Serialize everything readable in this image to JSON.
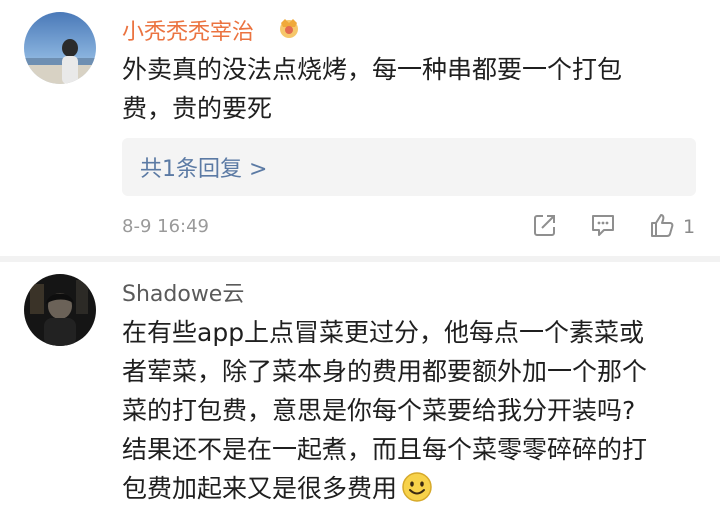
{
  "comments": [
    {
      "username": "小秃秃秃宰治",
      "lines": [
        "外卖真的没法点烧烤，每一种串都要一个打包",
        "费，贵的要死"
      ],
      "replies_label": "共1条回复 >",
      "timestamp": "8-9 16:49",
      "like_count": "1",
      "icons": [
        "vip-crown-icon",
        "share-icon",
        "comment-icon",
        "like-icon"
      ]
    },
    {
      "username": "Shadowe云",
      "lines": [
        "在有些app上点冒菜更过分，他每点一个素菜或",
        "者荤菜，除了菜本身的费用都要额外加一个那个",
        "菜的打包费，意思是你每个菜要给我分开装吗?",
        "结果还不是在一起煮，而且每个菜零零碎碎的打",
        "包费加起来又是很多费用"
      ],
      "icons": [
        "smile-emoji-icon"
      ]
    }
  ],
  "colors": {
    "username_highlight": "#eb7340",
    "username_normal": "#5a5a5a",
    "link": "#5b7aa4",
    "meta": "#9a9a9a"
  }
}
